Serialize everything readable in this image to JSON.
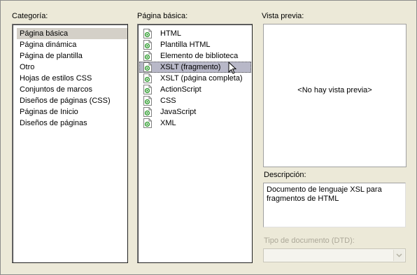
{
  "labels": {
    "categoria": "Categoría:",
    "pagina_basica": "Página básica:",
    "vista_previa": "Vista previa:",
    "descripcion": "Descripción:",
    "tipo_documento": "Tipo de documento (DTD):"
  },
  "categories": [
    {
      "label": "Página básica",
      "selected": true
    },
    {
      "label": "Página dinámica"
    },
    {
      "label": "Página de plantilla"
    },
    {
      "label": "Otro"
    },
    {
      "label": "Hojas de estilos CSS"
    },
    {
      "label": "Conjuntos de marcos"
    },
    {
      "label": "Diseños de páginas (CSS)"
    },
    {
      "label": "Páginas de Inicio"
    },
    {
      "label": "Diseños de páginas"
    }
  ],
  "page_types": [
    {
      "label": "HTML",
      "icon": "document-icon"
    },
    {
      "label": "Plantilla HTML",
      "icon": "document-icon"
    },
    {
      "label": "Elemento de biblioteca",
      "icon": "document-icon"
    },
    {
      "label": "XSLT (fragmento)",
      "icon": "document-icon",
      "selected": true
    },
    {
      "label": "XSLT (página completa)",
      "icon": "document-icon"
    },
    {
      "label": "ActionScript",
      "icon": "document-icon"
    },
    {
      "label": "CSS",
      "icon": "document-icon"
    },
    {
      "label": "JavaScript",
      "icon": "document-icon"
    },
    {
      "label": "XML",
      "icon": "document-icon"
    }
  ],
  "preview": {
    "empty_text": "<No hay vista previa>"
  },
  "description": {
    "text": "Documento de lenguaje XSL para fragmentos de HTML"
  },
  "dtd": {
    "value": "",
    "disabled": true
  },
  "colors": {
    "dialog_bg": "#ece9d8",
    "selected_item_bg": "#b8b8c8",
    "icon_green": "#2e9b2e"
  }
}
